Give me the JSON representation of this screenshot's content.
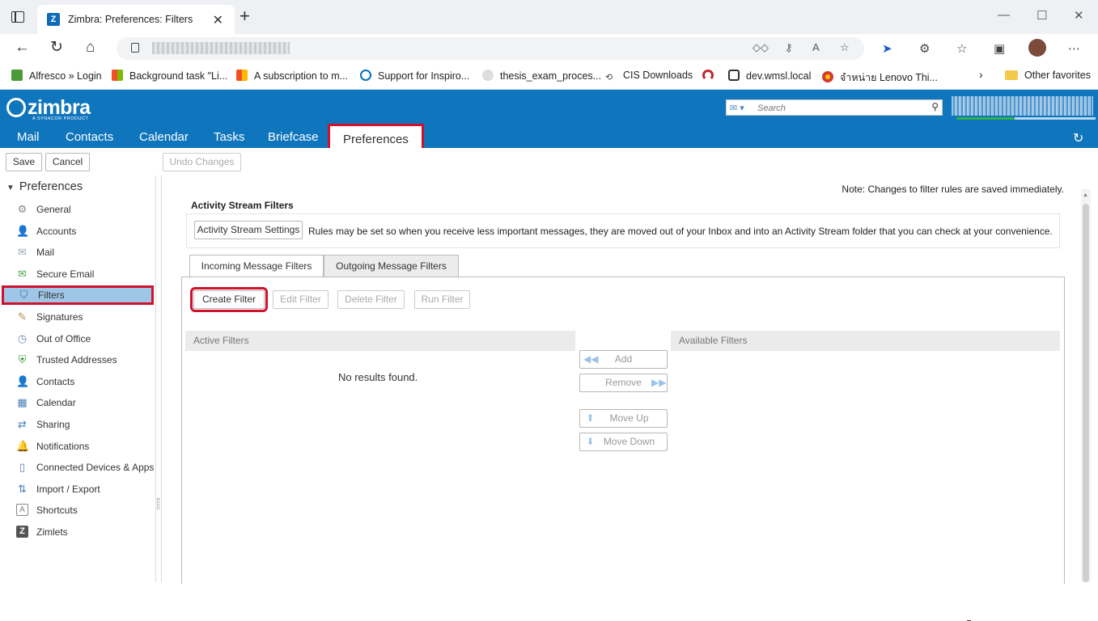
{
  "browser": {
    "tab_title": "Zimbra: Preferences: Filters",
    "tab_favicon": "Z",
    "bookmarks": [
      {
        "label": "Alfresco » Login",
        "color": "#4a9a3a"
      },
      {
        "label": "Background task \"Li...",
        "color": "#f2a900"
      },
      {
        "label": "A subscription to m...",
        "color": "#e15a1e"
      },
      {
        "label": "Support for Inspiro...",
        "color": "#0071bc"
      },
      {
        "label": "thesis_exam_proces...",
        "color": "#cccccc"
      },
      {
        "label": "CIS Downloads",
        "color": "#666666"
      },
      {
        "label": "",
        "color": "#c2272d"
      },
      {
        "label": "dev.wmsl.local",
        "color": "#333333"
      },
      {
        "label": "จำหน่าย Lenovo Thi...",
        "color": "#d33a2f"
      }
    ],
    "other_favorites": "Other favorites"
  },
  "zimbra": {
    "logo": "zimbra",
    "logo_sub": "A SYNACOR PRODUCT",
    "search_placeholder": "Search",
    "quota_fraction": 0.42,
    "app_tabs": [
      "Mail",
      "Contacts",
      "Calendar",
      "Tasks",
      "Briefcase",
      "Preferences"
    ],
    "active_app_tab": "Preferences"
  },
  "toolbar": {
    "save": "Save",
    "cancel": "Cancel",
    "undo": "Undo Changes"
  },
  "sidebar": {
    "header": "Preferences",
    "items": [
      {
        "label": "General",
        "icon": "gear-icon",
        "color": "#888888"
      },
      {
        "label": "Accounts",
        "icon": "accounts-icon",
        "color": "#4a7fb8"
      },
      {
        "label": "Mail",
        "icon": "mail-icon",
        "color": "#9aa7b5"
      },
      {
        "label": "Secure Email",
        "icon": "secure-email-icon",
        "color": "#4aa84a"
      },
      {
        "label": "Filters",
        "icon": "filter-icon",
        "color": "#2e6fb0"
      },
      {
        "label": "Signatures",
        "icon": "signature-icon",
        "color": "#b08a4a"
      },
      {
        "label": "Out of Office",
        "icon": "out-of-office-icon",
        "color": "#6a88b5"
      },
      {
        "label": "Trusted Addresses",
        "icon": "shield-icon",
        "color": "#3a9a3a"
      },
      {
        "label": "Contacts",
        "icon": "contacts-icon",
        "color": "#4a7fb8"
      },
      {
        "label": "Calendar",
        "icon": "calendar-icon",
        "color": "#4a7fb8"
      },
      {
        "label": "Sharing",
        "icon": "sharing-icon",
        "color": "#4a7fb8"
      },
      {
        "label": "Notifications",
        "icon": "bell-icon",
        "color": "#e8b824"
      },
      {
        "label": "Connected Devices & Apps",
        "icon": "device-icon",
        "color": "#5a7ab0"
      },
      {
        "label": "Import / Export",
        "icon": "import-export-icon",
        "color": "#4a7fb8"
      },
      {
        "label": "Shortcuts",
        "icon": "shortcuts-icon",
        "color": "#888888"
      },
      {
        "label": "Zimlets",
        "icon": "zimlets-icon",
        "color": "#555555"
      }
    ],
    "selected": "Filters"
  },
  "main": {
    "note": "Note: Changes to filter rules are saved immediately.",
    "activity_title": "Activity Stream Filters",
    "activity_button": "Activity Stream Settings",
    "activity_desc": "Rules may be set so when you receive less important messages, they are moved out of your Inbox and into an Activity Stream folder that you can check at your convenience.",
    "tabs": [
      "Incoming Message Filters",
      "Outgoing Message Filters"
    ],
    "actions": {
      "create": "Create Filter",
      "edit": "Edit Filter",
      "delete": "Delete Filter",
      "run": "Run Filter"
    },
    "active_filters_header": "Active Filters",
    "available_filters_header": "Available Filters",
    "no_results": "No results found.",
    "move_buttons": {
      "add": "Add",
      "remove": "Remove",
      "move_up": "Move Up",
      "move_down": "Move Down"
    }
  }
}
